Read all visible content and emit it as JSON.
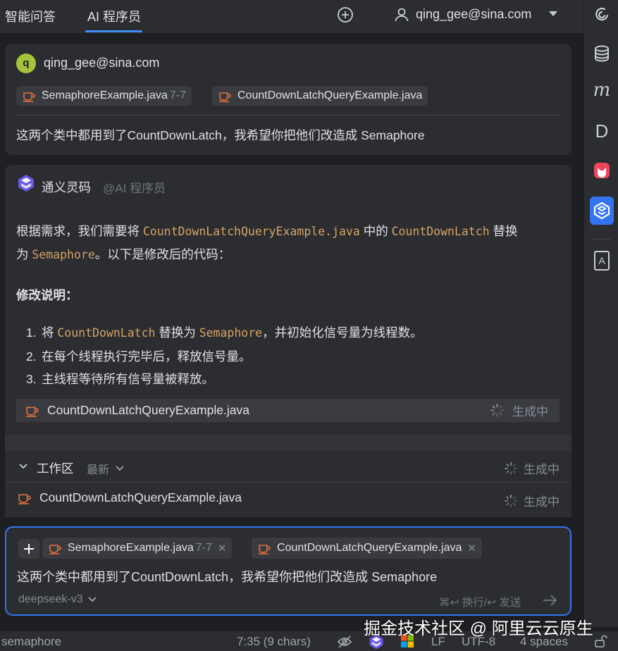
{
  "colors": {
    "accent": "#3574f0",
    "code": "#d7a365",
    "java_icon": "#e2703a",
    "avatar": "#a5c33a"
  },
  "topbar": {
    "tabs": [
      {
        "label": "智能问答",
        "active": false
      },
      {
        "label": "AI 程序员",
        "active": true
      }
    ],
    "new_chat_icon": "plus-circle-icon",
    "user_email": "qing_gee@sina.com"
  },
  "toolstrip": {
    "tools": [
      {
        "name": "swirl-icon"
      },
      {
        "name": "database-icon"
      },
      {
        "name": "m-icon",
        "text": "m"
      },
      {
        "name": "d-icon",
        "text": "D"
      },
      {
        "name": "fox-plugin-icon"
      },
      {
        "name": "tongyi-lingma-icon",
        "active": true
      },
      {
        "name": "dictionary-icon",
        "text": "A"
      }
    ]
  },
  "user_message": {
    "avatar_letter": "q",
    "email": "qing_gee@sina.com",
    "files": [
      {
        "name": "SemaphoreExample.java",
        "range": "7-7"
      },
      {
        "name": "CountDownLatchQueryExample.java",
        "range": ""
      }
    ],
    "text": "这两个类中都用到了CountDownLatch，我希望你把他们改造成 Semaphore"
  },
  "ai_message": {
    "name": "通义灵码",
    "mention": "@AI 程序员",
    "para": {
      "p1": "根据需求，我们需要将 ",
      "c1": "CountDownLatchQueryExample.java",
      "p2": " 中的 ",
      "c2": "CountDownLatch",
      "p3": " 替换",
      "p4": "为 ",
      "c3": "Semaphore",
      "p5": "。以下是修改后的代码："
    },
    "heading": "修改说明：",
    "list": [
      {
        "num": "1.",
        "a": "将 ",
        "code1": "CountDownLatch",
        "b": " 替换为 ",
        "code2": "Semaphore",
        "c": "，并初始化信号量为线程数。"
      },
      {
        "num": "2.",
        "text": "在每个线程执行完毕后，释放信号量。"
      },
      {
        "num": "3.",
        "text": "主线程等待所有信号量被释放。"
      }
    ],
    "file": "CountDownLatchQueryExample.java",
    "file_status": "生成中"
  },
  "workspace": {
    "title": "工作区",
    "filter": "最新",
    "status": "生成中",
    "file": "CountDownLatchQueryExample.java",
    "file_status": "生成中"
  },
  "input": {
    "files": [
      {
        "name": "SemaphoreExample.java",
        "range": "7-7"
      },
      {
        "name": "CountDownLatchQueryExample.java"
      }
    ],
    "text": "这两个类中都用到了CountDownLatch，我希望你把他们改造成 Semaphore",
    "model": "deepseek-v3",
    "hint": "⌘↩ 换行/↩ 发送"
  },
  "statusbar": {
    "left": "semaphore",
    "position": "7:35 (9 chars)",
    "line_ending": "LF",
    "encoding": "UTF-8",
    "indent": "4 spaces"
  },
  "watermark": "掘金技术社区 @ 阿里云云原生"
}
